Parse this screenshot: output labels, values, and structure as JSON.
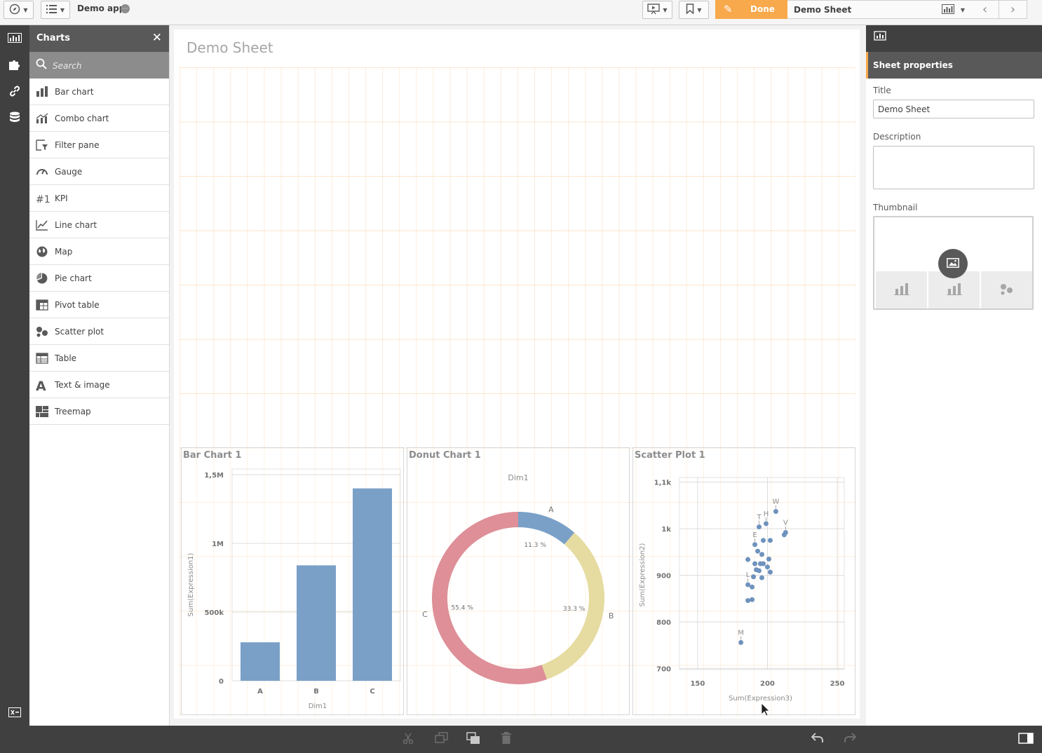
{
  "topbar": {
    "app_name": "Demo app",
    "done_label": "Done",
    "sheet_name": "Demo Sheet"
  },
  "rail": {
    "items": [
      "chart-icon",
      "puzzle-icon",
      "link-icon",
      "database-icon"
    ],
    "bottom": "variable-icon"
  },
  "panel": {
    "title": "Charts",
    "search_placeholder": "Search",
    "items": [
      {
        "label": "Bar chart",
        "icon": "bar-chart-icon"
      },
      {
        "label": "Combo chart",
        "icon": "combo-chart-icon"
      },
      {
        "label": "Filter pane",
        "icon": "filter-pane-icon"
      },
      {
        "label": "Gauge",
        "icon": "gauge-icon"
      },
      {
        "label": "KPI",
        "icon": "kpi-icon"
      },
      {
        "label": "Line chart",
        "icon": "line-chart-icon"
      },
      {
        "label": "Map",
        "icon": "map-icon"
      },
      {
        "label": "Pie chart",
        "icon": "pie-chart-icon"
      },
      {
        "label": "Pivot table",
        "icon": "pivot-table-icon"
      },
      {
        "label": "Scatter plot",
        "icon": "scatter-plot-icon"
      },
      {
        "label": "Table",
        "icon": "table-icon"
      },
      {
        "label": "Text & image",
        "icon": "text-image-icon"
      },
      {
        "label": "Treemap",
        "icon": "treemap-icon"
      }
    ]
  },
  "sheet": {
    "title": "Demo Sheet"
  },
  "props": {
    "header": "Sheet properties",
    "title_label": "Title",
    "title_value": "Demo Sheet",
    "description_label": "Description",
    "description_value": "",
    "thumbnail_label": "Thumbnail"
  },
  "colors": {
    "accent": "#f8a94c",
    "bar": "#7aa0c8",
    "donut_a": "#7aa0c8",
    "donut_b": "#e6dba0",
    "donut_c": "#de8f98",
    "scatter": "#6e92bd"
  },
  "chart_data": [
    {
      "type": "bar",
      "title": "Bar Chart 1",
      "categories": [
        "A",
        "B",
        "C"
      ],
      "values": [
        280000,
        840000,
        1400000
      ],
      "xlabel": "Dim1",
      "ylabel": "Sum(Expression1)",
      "ylim": [
        0,
        1500000
      ],
      "ticks": [
        0,
        500000,
        1000000,
        1500000
      ],
      "tick_labels": [
        "0",
        "500k",
        "1M",
        "1,5M"
      ],
      "grid": true
    },
    {
      "type": "pie",
      "title": "Donut Chart 1",
      "subtitle": "Dim1",
      "categories": [
        "A",
        "B",
        "C"
      ],
      "values": [
        11.3,
        33.3,
        55.4
      ],
      "value_labels": [
        "11.3 %",
        "33.3 %",
        "55.4 %"
      ]
    },
    {
      "type": "scatter",
      "title": "Scatter Plot 1",
      "xlabel": "Sum(Expression3)",
      "ylabel": "Sum(Expression2)",
      "xlim": [
        137,
        255
      ],
      "ylim": [
        698,
        1110
      ],
      "xticks": [
        150,
        200,
        250
      ],
      "xtick_labels": [
        "150",
        "200",
        "250"
      ],
      "yticks": [
        700,
        800,
        900,
        1000,
        1100
      ],
      "ytick_labels": [
        "700",
        "800",
        "900",
        "1k",
        "1,1k"
      ],
      "grid": true,
      "points": [
        {
          "x": 206,
          "y": 1037,
          "label": "W"
        },
        {
          "x": 213,
          "y": 992,
          "label": "V"
        },
        {
          "x": 212,
          "y": 987,
          "label": ""
        },
        {
          "x": 199,
          "y": 1011,
          "label": "H"
        },
        {
          "x": 194,
          "y": 1004,
          "label": "T"
        },
        {
          "x": 191,
          "y": 966,
          "label": "E"
        },
        {
          "x": 197,
          "y": 975,
          "label": ""
        },
        {
          "x": 202,
          "y": 975,
          "label": ""
        },
        {
          "x": 193,
          "y": 952,
          "label": ""
        },
        {
          "x": 196,
          "y": 945,
          "label": ""
        },
        {
          "x": 186,
          "y": 934,
          "label": ""
        },
        {
          "x": 201,
          "y": 935,
          "label": ""
        },
        {
          "x": 191,
          "y": 925,
          "label": ""
        },
        {
          "x": 195,
          "y": 925,
          "label": ""
        },
        {
          "x": 197,
          "y": 925,
          "label": ""
        },
        {
          "x": 200,
          "y": 918,
          "label": ""
        },
        {
          "x": 192,
          "y": 912,
          "label": ""
        },
        {
          "x": 194,
          "y": 910,
          "label": ""
        },
        {
          "x": 202,
          "y": 907,
          "label": ""
        },
        {
          "x": 190,
          "y": 897,
          "label": ""
        },
        {
          "x": 196,
          "y": 895,
          "label": ""
        },
        {
          "x": 186,
          "y": 880,
          "label": "L"
        },
        {
          "x": 189,
          "y": 875,
          "label": ""
        },
        {
          "x": 186,
          "y": 846,
          "label": ""
        },
        {
          "x": 189,
          "y": 848,
          "label": ""
        },
        {
          "x": 181,
          "y": 756,
          "label": "M"
        }
      ]
    }
  ]
}
